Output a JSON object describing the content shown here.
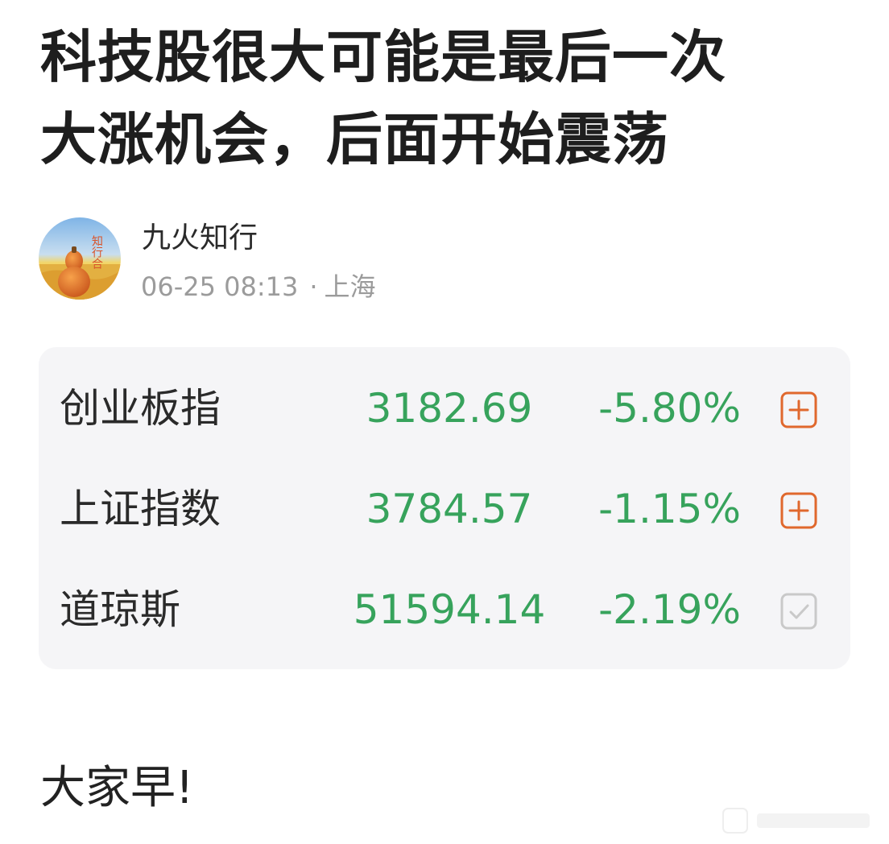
{
  "article": {
    "title_line1": "科技股很大可能是最后一次",
    "title_line2": "大涨机会，后面开始震荡"
  },
  "author": {
    "name": "九火知行",
    "date": "06-25 08:13",
    "separator": "·",
    "location": "上海",
    "avatar_text": "知行合"
  },
  "stocks": [
    {
      "name": "创业板指",
      "price": "3182.69",
      "change": "-5.80%",
      "action": "add-icon"
    },
    {
      "name": "上证指数",
      "price": "3784.57",
      "change": "-1.15%",
      "action": "add-icon"
    },
    {
      "name": "道琼斯",
      "price": "51594.14",
      "change": "-2.19%",
      "action": "checked-icon"
    }
  ],
  "body": {
    "greeting": "大家早!"
  },
  "colors": {
    "down_green": "#37a35c",
    "add_orange": "#e0682d",
    "checked_gray": "#c9c9c9",
    "card_bg": "#f5f5f7"
  }
}
